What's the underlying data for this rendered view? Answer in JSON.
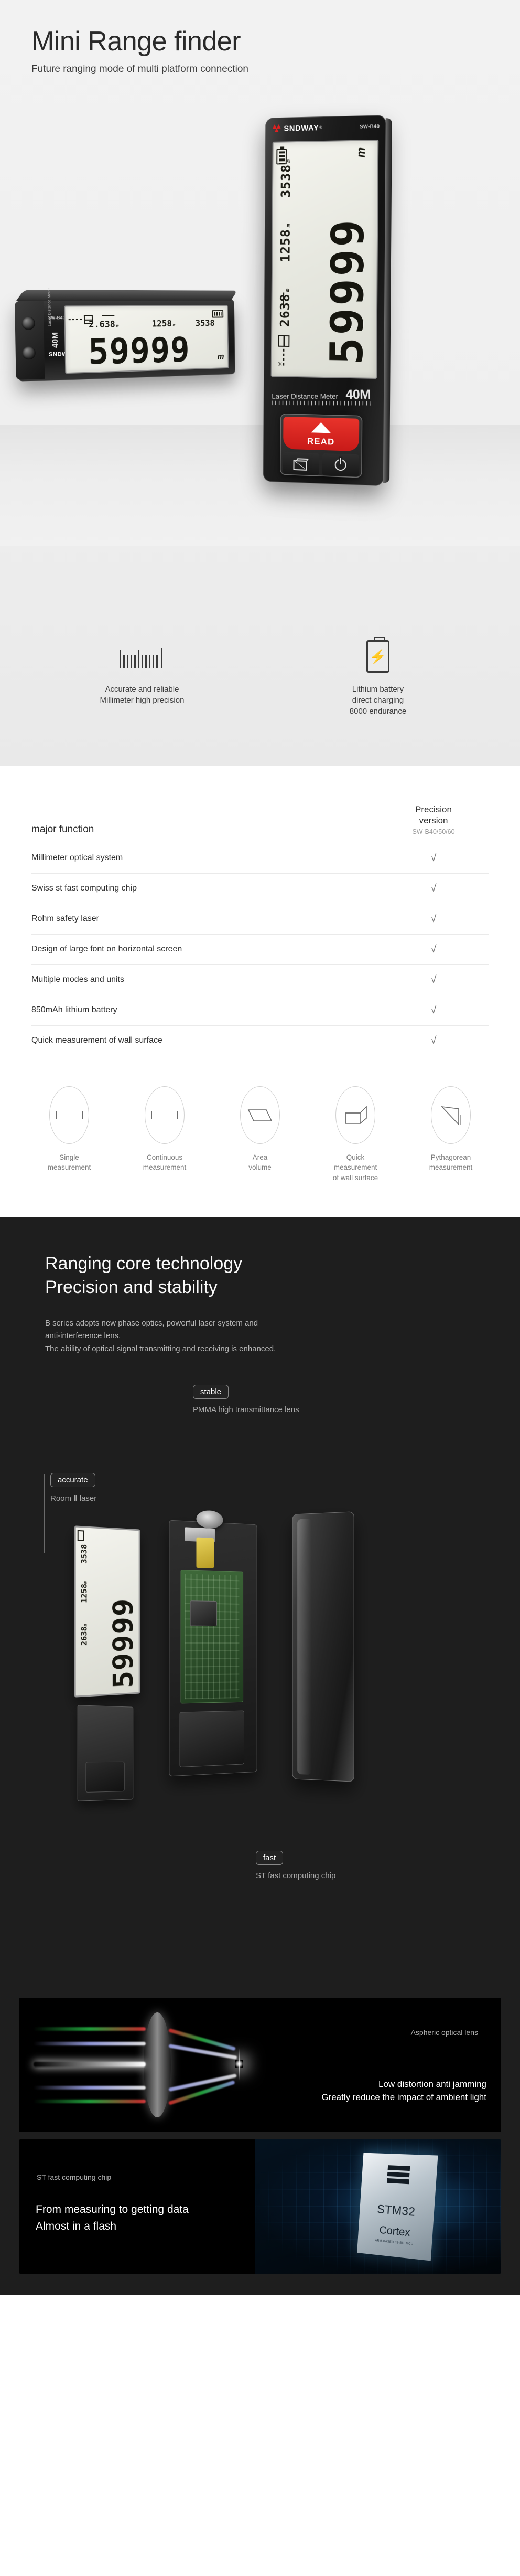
{
  "hero": {
    "title": "Mini Range finder",
    "subtitle": "Future ranging mode of multi platform connection",
    "device_upright": {
      "brand": "SNDWAY",
      "brand_reg": "®",
      "model": "SW-B40",
      "display_main": "59999",
      "display_unit": "m",
      "display_sub_1": "2638",
      "display_sub_2": "1258",
      "display_sub_3": "3538",
      "display_sub_unit": "m",
      "face_label": "Laser Distance Meter",
      "range_label": "40M",
      "read_button": "READ",
      "volume_icon": "volume-cube-icon",
      "power_icon": "power-icon"
    },
    "device_horizontal": {
      "brand": "SNDWAY",
      "model": "SW-B40",
      "display_main": "59999",
      "display_unit": "m",
      "display_sub_1": "2.638",
      "display_sub_2": "1258",
      "display_sub_3": "3538",
      "display_sub_unit": "m",
      "side_label": "Laser Distance Meter",
      "range_label": "40M"
    },
    "features": [
      {
        "icon": "ruler-precision-icon",
        "line1": "Accurate and reliable",
        "line2": "Millimeter high precision",
        "line3": ""
      },
      {
        "icon": "battery-charging-icon",
        "line1": "Lithium battery",
        "line2": "direct charging",
        "line3": "8000 endurance"
      }
    ]
  },
  "table": {
    "col_function": "major function",
    "col_version_line1": "Precision",
    "col_version_line2": "version",
    "col_version_models": "SW-B40/50/60",
    "check_mark": "√",
    "rows": [
      {
        "feature": "Millimeter optical system",
        "supported": "√"
      },
      {
        "feature": "Swiss st fast computing chip",
        "supported": "√"
      },
      {
        "feature": "Rohm safety laser",
        "supported": "√"
      },
      {
        "feature": "Design of large font on horizontal screen",
        "supported": "√"
      },
      {
        "feature": "Multiple modes and units",
        "supported": "√"
      },
      {
        "feature": "850mAh lithium battery",
        "supported": "√"
      },
      {
        "feature": "Quick measurement of wall surface",
        "supported": "√"
      }
    ]
  },
  "modes": [
    {
      "icon": "single-measure-icon",
      "line1": "Single",
      "line2": "measurement",
      "line3": ""
    },
    {
      "icon": "continuous-measure-icon",
      "line1": "Continuous",
      "line2": "measurement",
      "line3": ""
    },
    {
      "icon": "area-volume-icon",
      "line1": "Area",
      "line2": "volume",
      "line3": ""
    },
    {
      "icon": "wall-surface-icon",
      "line1": "Quick",
      "line2": "measurement",
      "line3": "of wall surface"
    },
    {
      "icon": "pythagorean-icon",
      "line1": "Pythagorean",
      "line2": "measurement",
      "line3": ""
    }
  ],
  "tech": {
    "heading_line1": "Ranging core technology",
    "heading_line2": "Precision and stability",
    "body_line1": "B series adopts new phase optics, powerful laser system and",
    "body_line2": "anti-interference lens,",
    "body_line3": "The ability of optical signal transmitting and receiving is enhanced.",
    "callouts": [
      {
        "badge": "stable",
        "caption": "PMMA high transmittance lens"
      },
      {
        "badge": "accurate",
        "caption": "Room Ⅱ laser"
      },
      {
        "badge": "fast",
        "caption": "ST fast computing chip"
      }
    ],
    "exploded_display": {
      "main": "59999",
      "sub_1": "2638",
      "sub_2": "1258",
      "sub_3": "3538",
      "unit": "m"
    }
  },
  "panels": [
    {
      "label": "Aspheric optical lens",
      "headline_line1": "Low distortion anti jamming",
      "headline_line2": "Greatly reduce the impact of ambient light",
      "graphic": "aspheric-lens-rays-graphic"
    },
    {
      "label": "ST fast computing chip",
      "headline_line1": "From measuring to getting data",
      "headline_line2": "Almost in a flash",
      "chip_brand": "ST",
      "chip_line1": "STM32",
      "chip_line2": "Cortex",
      "chip_line3": "ARM-BASED 32-BIT MCU",
      "graphic": "stm32-chip-graphic"
    }
  ]
}
